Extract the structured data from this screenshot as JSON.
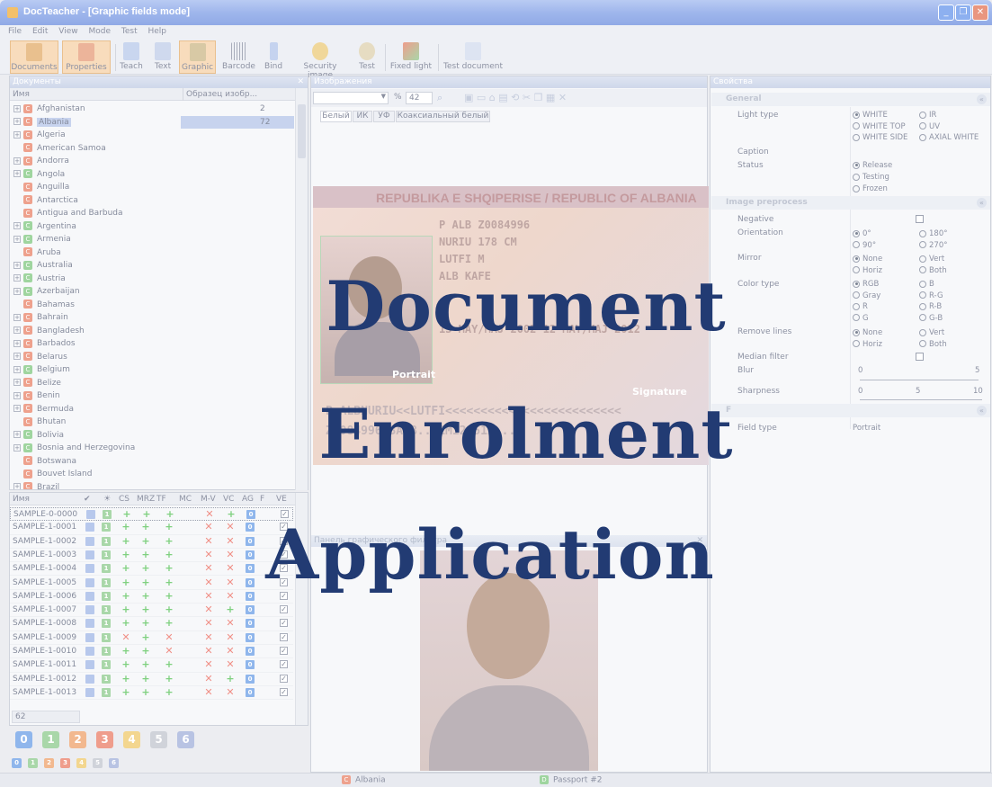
{
  "window": {
    "title": "DocTeacher - [Graphic fields mode]",
    "buttons": [
      "_",
      "❐",
      "✕"
    ]
  },
  "menu": [
    "File",
    "Edit",
    "View",
    "Mode",
    "Test",
    "Help"
  ],
  "toolbar": {
    "items": [
      {
        "label": "Documents",
        "icon": "documents-icon",
        "active": true
      },
      {
        "label": "Properties",
        "icon": "properties-icon",
        "active": true
      },
      {
        "label": "Teach",
        "icon": "teach-icon",
        "active": false
      },
      {
        "label": "Text",
        "icon": "text-icon",
        "active": false
      },
      {
        "label": "Graphic",
        "icon": "graphic-icon",
        "active": true
      },
      {
        "label": "Barcode",
        "icon": "barcode-icon",
        "active": false
      },
      {
        "label": "Bind",
        "icon": "paperclip-icon",
        "active": false
      },
      {
        "label": "Security image",
        "icon": "security-image-icon",
        "active": false
      },
      {
        "label": "Test",
        "icon": "magnifier-icon",
        "active": false
      },
      {
        "label": "Fixed light",
        "icon": "fixed-light-icon",
        "active": false
      },
      {
        "label": "Test document",
        "icon": "test-document-icon",
        "active": false
      }
    ]
  },
  "documents_panel": {
    "title": "Документы",
    "col_name": "Имя",
    "col_sample": "Образец изобр...",
    "items": [
      {
        "name": "Afghanistan",
        "count": "2",
        "icon": "red",
        "expand": true
      },
      {
        "name": "Albania",
        "count": "72",
        "icon": "red",
        "expand": true,
        "selected": true
      },
      {
        "name": "Algeria",
        "count": "",
        "icon": "red",
        "expand": true
      },
      {
        "name": "American Samoa",
        "count": "",
        "icon": "red",
        "expand": false
      },
      {
        "name": "Andorra",
        "count": "",
        "icon": "red",
        "expand": true
      },
      {
        "name": "Angola",
        "count": "",
        "icon": "green",
        "expand": true
      },
      {
        "name": "Anguilla",
        "count": "",
        "icon": "red",
        "expand": false
      },
      {
        "name": "Antarctica",
        "count": "",
        "icon": "red",
        "expand": false
      },
      {
        "name": "Antigua and Barbuda",
        "count": "",
        "icon": "red",
        "expand": false
      },
      {
        "name": "Argentina",
        "count": "",
        "icon": "green",
        "expand": true
      },
      {
        "name": "Armenia",
        "count": "",
        "icon": "green",
        "expand": true
      },
      {
        "name": "Aruba",
        "count": "",
        "icon": "red",
        "expand": false
      },
      {
        "name": "Australia",
        "count": "",
        "icon": "green",
        "expand": true
      },
      {
        "name": "Austria",
        "count": "",
        "icon": "green",
        "expand": true
      },
      {
        "name": "Azerbaijan",
        "count": "",
        "icon": "green",
        "expand": true
      },
      {
        "name": "Bahamas",
        "count": "",
        "icon": "red",
        "expand": false
      },
      {
        "name": "Bahrain",
        "count": "",
        "icon": "red",
        "expand": true
      },
      {
        "name": "Bangladesh",
        "count": "",
        "icon": "red",
        "expand": true
      },
      {
        "name": "Barbados",
        "count": "",
        "icon": "red",
        "expand": true
      },
      {
        "name": "Belarus",
        "count": "",
        "icon": "red",
        "expand": true
      },
      {
        "name": "Belgium",
        "count": "",
        "icon": "green",
        "expand": true
      },
      {
        "name": "Belize",
        "count": "",
        "icon": "red",
        "expand": true
      },
      {
        "name": "Benin",
        "count": "",
        "icon": "red",
        "expand": true
      },
      {
        "name": "Bermuda",
        "count": "",
        "icon": "red",
        "expand": true
      },
      {
        "name": "Bhutan",
        "count": "",
        "icon": "red",
        "expand": false
      },
      {
        "name": "Bolivia",
        "count": "",
        "icon": "green",
        "expand": true
      },
      {
        "name": "Bosnia and Herzegovina",
        "count": "",
        "icon": "green",
        "expand": true
      },
      {
        "name": "Botswana",
        "count": "",
        "icon": "red",
        "expand": false
      },
      {
        "name": "Bouvet Island",
        "count": "",
        "icon": "red",
        "expand": false
      },
      {
        "name": "Brazil",
        "count": "",
        "icon": "red",
        "expand": true
      }
    ]
  },
  "samples_grid": {
    "headers": [
      "Имя",
      "✔",
      "☀",
      "CS",
      "MRZ",
      "TF",
      "MC",
      "M-V",
      "VC",
      "AG",
      "F",
      "VE"
    ],
    "rows": [
      {
        "name": "SAMPLE-0-0000",
        "cs": "+",
        "mrz": "+",
        "tf": "+",
        "mv": "x",
        "vc": "+"
      },
      {
        "name": "SAMPLE-1-0001",
        "cs": "+",
        "mrz": "+",
        "tf": "+",
        "mv": "x",
        "vc": "x"
      },
      {
        "name": "SAMPLE-1-0002",
        "cs": "+",
        "mrz": "+",
        "tf": "+",
        "mv": "x",
        "vc": "x"
      },
      {
        "name": "SAMPLE-1-0003",
        "cs": "+",
        "mrz": "+",
        "tf": "+",
        "mv": "x",
        "vc": "x"
      },
      {
        "name": "SAMPLE-1-0004",
        "cs": "+",
        "mrz": "+",
        "tf": "+",
        "mv": "x",
        "vc": "x"
      },
      {
        "name": "SAMPLE-1-0005",
        "cs": "+",
        "mrz": "+",
        "tf": "+",
        "mv": "x",
        "vc": "x"
      },
      {
        "name": "SAMPLE-1-0006",
        "cs": "+",
        "mrz": "+",
        "tf": "+",
        "mv": "x",
        "vc": "x"
      },
      {
        "name": "SAMPLE-1-0007",
        "cs": "+",
        "mrz": "+",
        "tf": "+",
        "mv": "x",
        "vc": "+"
      },
      {
        "name": "SAMPLE-1-0008",
        "cs": "+",
        "mrz": "+",
        "tf": "+",
        "mv": "x",
        "vc": "x"
      },
      {
        "name": "SAMPLE-1-0009",
        "cs": "x",
        "mrz": "+",
        "tf": "x",
        "mv": "x",
        "vc": "x"
      },
      {
        "name": "SAMPLE-1-0010",
        "cs": "+",
        "mrz": "+",
        "tf": "x",
        "mv": "x",
        "vc": "x"
      },
      {
        "name": "SAMPLE-1-0011",
        "cs": "+",
        "mrz": "+",
        "tf": "+",
        "mv": "x",
        "vc": "x"
      },
      {
        "name": "SAMPLE-1-0012",
        "cs": "+",
        "mrz": "+",
        "tf": "+",
        "mv": "x",
        "vc": "+"
      },
      {
        "name": "SAMPLE-1-0013",
        "cs": "+",
        "mrz": "+",
        "tf": "+",
        "mv": "x",
        "vc": "x"
      }
    ],
    "count": "62"
  },
  "badges_large": [
    {
      "label": "0",
      "color": "#8fb6ec"
    },
    {
      "label": "1",
      "color": "#a9d7a9"
    },
    {
      "label": "2",
      "color": "#f2b88f"
    },
    {
      "label": "3",
      "color": "#ef9d8c"
    },
    {
      "label": "4",
      "color": "#f3d68f"
    },
    {
      "label": "5",
      "color": "#d0d3da"
    },
    {
      "label": "6",
      "color": "#b8c3e3"
    }
  ],
  "images_panel": {
    "title": "Изображения",
    "zoom": "42",
    "zoom_unit": "%",
    "tabs": [
      "Белый",
      "ИК",
      "УФ",
      "Коаксиальный белый"
    ],
    "passport": {
      "header": "REPUBLIKA E SHQIPERISE / REPUBLIC OF ALBANIA",
      "lines": [
        "P     ALB     Z0084996",
        "NURIU        178 CM",
        "LUTFI        M",
        "ALB          KAFE",
        "13 MAY/MAJ 2002   12 MAY/MAJ 2012"
      ],
      "portrait_label": "Portrait",
      "signature_label": "Signature",
      "mrz": [
        "P<ALBNURIU<<LUTFI<<<<<<<<<<<<<<<<<<<<<<<<<",
        "Z0084996<3ALB...1M120512..."
      ]
    },
    "bottom_panel_title": "Панель графического фильтра"
  },
  "properties_panel": {
    "title": "Свойства",
    "sections": {
      "general": "General",
      "preprocess": "Image preprocess",
      "field": "F"
    },
    "light_type_label": "Light type",
    "light_options": [
      "WHITE",
      "IR",
      "WHITE TOP",
      "UV",
      "WHITE SIDE",
      "AXIAL WHITE"
    ],
    "caption_label": "Caption",
    "status_label": "Status",
    "status_options": [
      "Release",
      "Testing",
      "Frozen"
    ],
    "negative_label": "Negative",
    "orientation_label": "Orientation",
    "orientation_options": [
      "0°",
      "180°",
      "90°",
      "270°"
    ],
    "mirror_label": "Mirror",
    "mirror_options": [
      "None",
      "Vert",
      "Horiz",
      "Both"
    ],
    "color_type_label": "Color type",
    "color_options": [
      "RGB",
      "B",
      "Gray",
      "R-G",
      "R",
      "R-B",
      "G",
      "G-B"
    ],
    "remove_lines_label": "Remove lines",
    "remove_lines_options": [
      "None",
      "Vert",
      "Horiz",
      "Both"
    ],
    "median_filter_label": "Median filter",
    "blur_label": "Blur",
    "blur_range": [
      "0",
      "5"
    ],
    "sharpness_label": "Sharpness",
    "sharpness_range": [
      "0",
      "5",
      "10"
    ],
    "field_type_label": "Field type",
    "field_type_value": "Portrait"
  },
  "statusbar": {
    "country": "Albania",
    "document": "Passport #2"
  },
  "watermark": {
    "line1": "Document",
    "line2": "Enrolment",
    "line3": "Application",
    "color": "#223b73"
  }
}
